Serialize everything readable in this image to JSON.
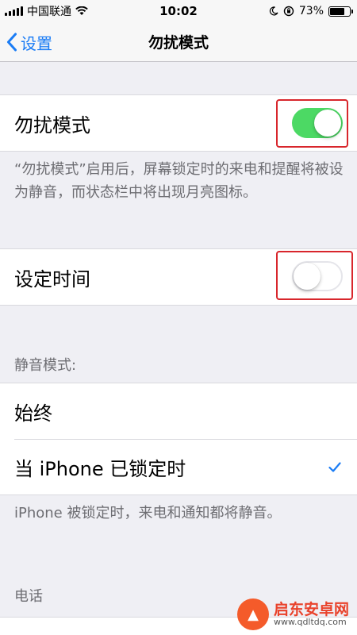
{
  "status_bar": {
    "carrier": "中国联通",
    "time": "10:02",
    "battery_percent": "73%",
    "battery_level": 0.73,
    "icons": [
      "signal-icon",
      "wifi-icon",
      "moon-icon",
      "rotation-lock-icon",
      "battery-icon"
    ]
  },
  "nav": {
    "back_label": "设置",
    "title": "勿扰模式"
  },
  "dnd": {
    "label": "勿扰模式",
    "enabled": true,
    "description": "“勿扰模式”启用后，屏幕锁定时的来电和提醒将被设为静音，而状态栏中将出现月亮图标。"
  },
  "scheduled": {
    "label": "设定时间",
    "enabled": false
  },
  "silence": {
    "header": "静音模式:",
    "options": [
      {
        "label": "始终",
        "selected": false
      },
      {
        "label": "当 iPhone 已锁定时",
        "selected": true
      }
    ],
    "footer": "iPhone 被锁定时，来电和通知都将静音。"
  },
  "phone": {
    "header": "电话"
  },
  "watermark": {
    "title": "启东安卓网",
    "url": "www.qdltdq.com"
  },
  "colors": {
    "accent": "#1a7cf5",
    "switch_on": "#4cd964",
    "highlight": "#d8262c"
  }
}
